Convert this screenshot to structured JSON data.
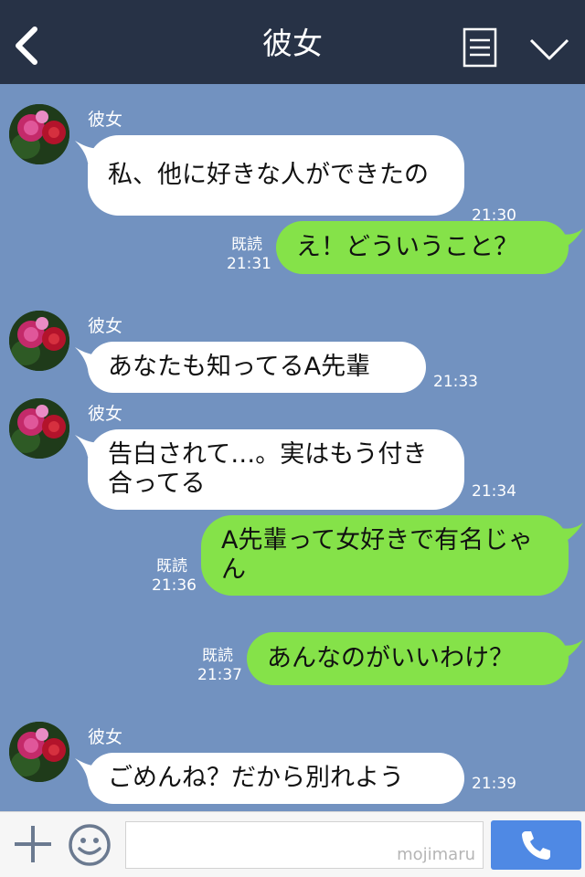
{
  "header": {
    "title": "彼女",
    "back_icon": "chevron-left-icon",
    "menu_icon": "notes-icon",
    "dropdown_icon": "chevron-down-icon"
  },
  "messages": [
    {
      "side": "left",
      "sender": "彼女",
      "text": "私、他に好きな人ができたの",
      "time": "21:30"
    },
    {
      "side": "right",
      "read": "既読",
      "text": "え！どういうこと？",
      "time": "21:31"
    },
    {
      "side": "left",
      "sender": "彼女",
      "text": "あなたも知ってるA先輩",
      "time": "21:33"
    },
    {
      "side": "left",
      "sender": "彼女",
      "text": "告白されて…。実はもう付き合ってる",
      "time": "21:34"
    },
    {
      "side": "right",
      "read": "既読",
      "text": "A先輩って女好きで有名じゃん",
      "time": "21:36"
    },
    {
      "side": "right",
      "read": "既読",
      "text": "あんなのがいいわけ？",
      "time": "21:37"
    },
    {
      "side": "left",
      "sender": "彼女",
      "text": "ごめんね？だから別れよう",
      "time": "21:39"
    }
  ],
  "input": {
    "placeholder": "",
    "watermark": "mojimaru",
    "plus_icon": "plus-icon",
    "emoji_icon": "smiley-icon",
    "send_icon": "phone-icon"
  },
  "colors": {
    "header_bg": "#273246",
    "chat_bg": "#7292c0",
    "incoming_bubble": "#ffffff",
    "outgoing_bubble": "#85e249",
    "send_button": "#4f89e4"
  }
}
